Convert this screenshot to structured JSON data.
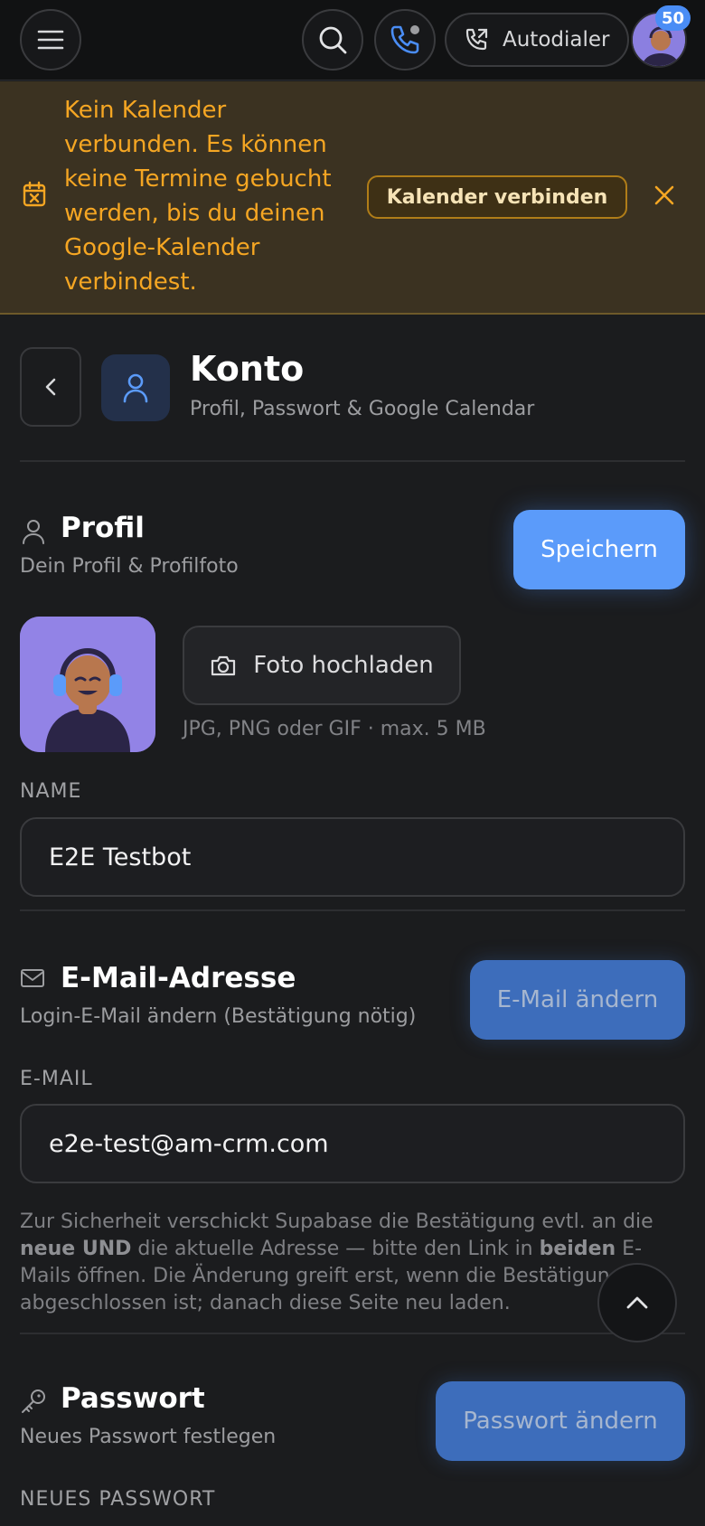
{
  "topbar": {
    "menu_icon": "hamburger-icon",
    "search_icon": "search-icon",
    "phone_icon": "phone-icon",
    "autodialer_label": "Autodialer",
    "notification_count": "50"
  },
  "banner": {
    "message": "Kein Kalender verbunden. Es können keine Termine gebucht werden, bis du deinen Google-Kalender verbindest.",
    "connect_label": "Kalender verbinden",
    "accent_color": "#f5a623"
  },
  "header": {
    "title": "Konto",
    "subtitle": "Profil, Passwort & Google Calendar"
  },
  "profile": {
    "title": "Profil",
    "subtitle": "Dein Profil & Profilfoto",
    "save_label": "Speichern",
    "upload_label": "Foto hochladen",
    "upload_hint": "JPG, PNG oder GIF · max. 5 MB",
    "name_label": "NAME",
    "name_value": "E2E Testbot"
  },
  "email": {
    "title": "E-Mail-Adresse",
    "subtitle": "Login-E-Mail ändern (Bestätigung nötig)",
    "change_label": "E-Mail ändern",
    "field_label": "E-MAIL",
    "field_value": "e2e-test@am-crm.com",
    "note_part1": "Zur Sicherheit verschickt Supabase die Bestätigung evtl. an die ",
    "note_bold1": "neue UND",
    "note_part2": " die aktuelle Adresse — bitte den Link in ",
    "note_bold2": "beiden",
    "note_part3": " E-Mails öffnen. Die Änderung greift erst, wenn die Bestätigung abgeschlossen ist; danach diese Seite neu laden."
  },
  "password": {
    "title": "Passwort",
    "subtitle": "Neues Passwort festlegen",
    "change_label": "Passwort ändern",
    "field_label": "NEUES PASSWORT"
  },
  "colors": {
    "primary": "#5b9bfa",
    "background": "#1b1c1e"
  }
}
